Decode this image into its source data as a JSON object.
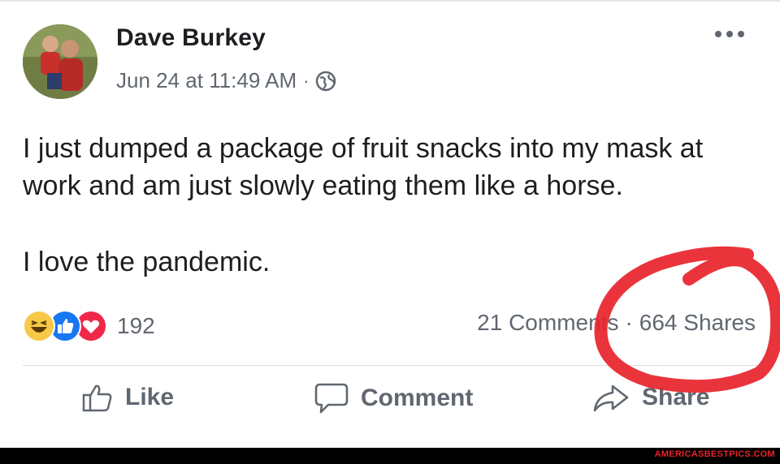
{
  "post": {
    "author": "Dave Burkey",
    "date": "Jun 24 at 11:49 AM",
    "separator": "·",
    "privacy_icon": "globe-icon",
    "more_icon": "more-options-icon",
    "body": [
      "I just dumped a package of fruit snacks into my mask at work and am just slowly eating them like a horse.",
      "I love the pandemic."
    ]
  },
  "reactions": {
    "icons": [
      "haha-reaction-icon",
      "like-reaction-icon",
      "love-reaction-icon"
    ],
    "count": "192"
  },
  "stats": {
    "comments": "21 Comments",
    "separator": "·",
    "shares": "664 Shares"
  },
  "actions": {
    "like": "Like",
    "comment": "Comment",
    "share": "Share"
  },
  "watermark": "AMERICASBESTPICS.COM",
  "colors": {
    "like_blue": "#1877f2",
    "love_red": "#f0284a",
    "haha_yellow": "#f7c948",
    "annotation_red": "#e8232b",
    "meta_gray": "#606770"
  }
}
